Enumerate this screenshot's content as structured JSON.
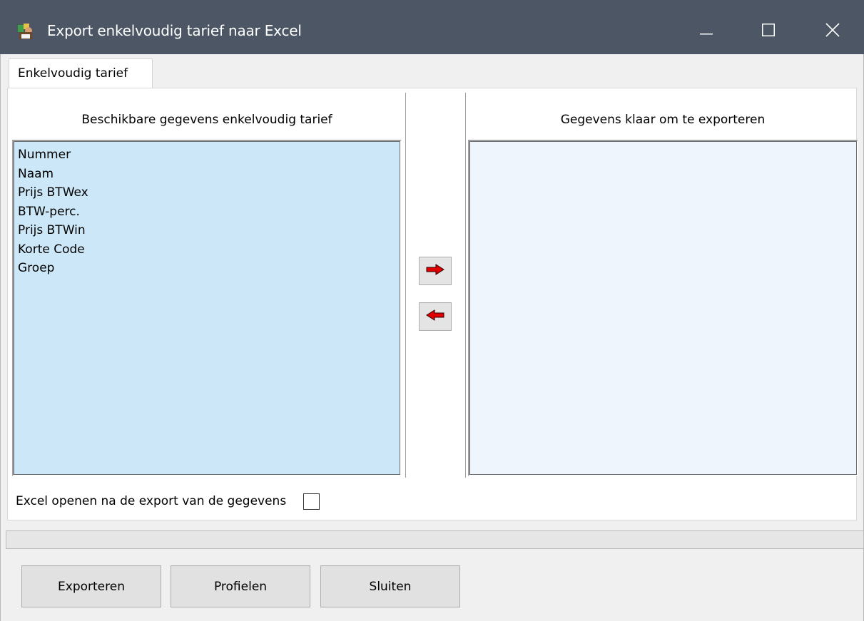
{
  "window": {
    "title": "Export enkelvoudig tarief naar Excel",
    "titlebar_color": "#4c5664",
    "controls": {
      "minimize_icon": "minimize-icon",
      "maximize_icon": "maximize-icon",
      "close_icon": "close-icon"
    }
  },
  "tabs": [
    {
      "label": "Enkelvoudig tarief",
      "active": true
    }
  ],
  "available": {
    "header": "Beschikbare gegevens enkelvoudig tarief",
    "items": [
      "Nummer",
      "Naam",
      "Prijs BTWex",
      "BTW-perc.",
      "Prijs BTWin",
      "Korte Code",
      "Groep"
    ],
    "background": "#cce8f8"
  },
  "selected": {
    "header": "Gegevens klaar om te exporteren",
    "items": [],
    "background": "#eef5fd"
  },
  "move_buttons": {
    "add_icon": "red-arrow-right-icon",
    "remove_icon": "red-arrow-left-icon",
    "arrow_color": "#e00000"
  },
  "options": {
    "open_excel_label": "Excel openen na de export van de gegevens",
    "open_excel_checked": false
  },
  "progress": {
    "value": 0
  },
  "buttons": {
    "export": "Exporteren",
    "profiles": "Profielen",
    "close": "Sluiten"
  }
}
